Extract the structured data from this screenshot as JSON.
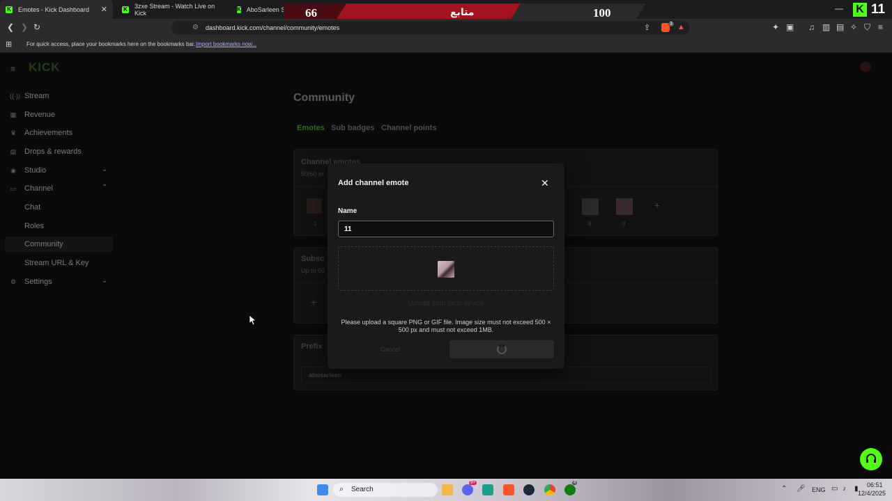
{
  "browser": {
    "tabs": [
      {
        "title": "Emotes - Kick Dashboard",
        "active": true
      },
      {
        "title": "3zxe Stream - Watch Live on Kick",
        "active": false
      },
      {
        "title": "AboSarleen Stream",
        "active": false
      }
    ],
    "url": "dashboard.kick.com/channel/community/emotes",
    "bookmarks_text": "For quick access, place your bookmarks here on the bookmarks bar.",
    "bookmarks_link": "Import bookmarks now...",
    "ext_badge": "3"
  },
  "stream_overlay": {
    "left_number": "66",
    "center_text": "متابع",
    "right_number": "100",
    "kick_count": "11"
  },
  "brand": {
    "logo_text": "KICK",
    "accent": "#53fc18"
  },
  "sidebar": {
    "items": [
      {
        "label": "Stream",
        "icon": "broadcast-icon"
      },
      {
        "label": "Revenue",
        "icon": "revenue-icon"
      },
      {
        "label": "Achievements",
        "icon": "trophy-icon"
      },
      {
        "label": "Drops & rewards",
        "icon": "drops-icon"
      },
      {
        "label": "Studio",
        "icon": "studio-icon"
      },
      {
        "label": "Channel",
        "icon": "channel-icon"
      },
      {
        "label": "Chat"
      },
      {
        "label": "Roles"
      },
      {
        "label": "Community"
      },
      {
        "label": "Stream URL & Key"
      },
      {
        "label": "Settings",
        "icon": "settings-icon"
      }
    ]
  },
  "main": {
    "title": "Community",
    "tabs": [
      "Emotes",
      "Sub badges",
      "Channel points"
    ],
    "channel_emotes_title": "Channel emotes",
    "channel_emotes_sub": "50/60 er",
    "emote_numbers": [
      "1",
      "8",
      "9"
    ],
    "subs_title": "Subsc",
    "subs_sub": "Up to 60",
    "prefix_title": "Prefix",
    "prefix_value": "abosarleen"
  },
  "modal": {
    "title": "Add channel emote",
    "name_label": "Name",
    "name_value": "11",
    "upload_label": "Upload from local device",
    "hint": "Please upload a square PNG or GIF file. Image size must not exceed 500 × 500 px and must not exceed 1MB.",
    "cancel_label": "Cancel"
  },
  "taskbar": {
    "search_placeholder": "Search",
    "language": "ENG",
    "time": "06:51",
    "date": "12/4/2025",
    "discord_badge": "9+",
    "xbox_badge": "4"
  }
}
